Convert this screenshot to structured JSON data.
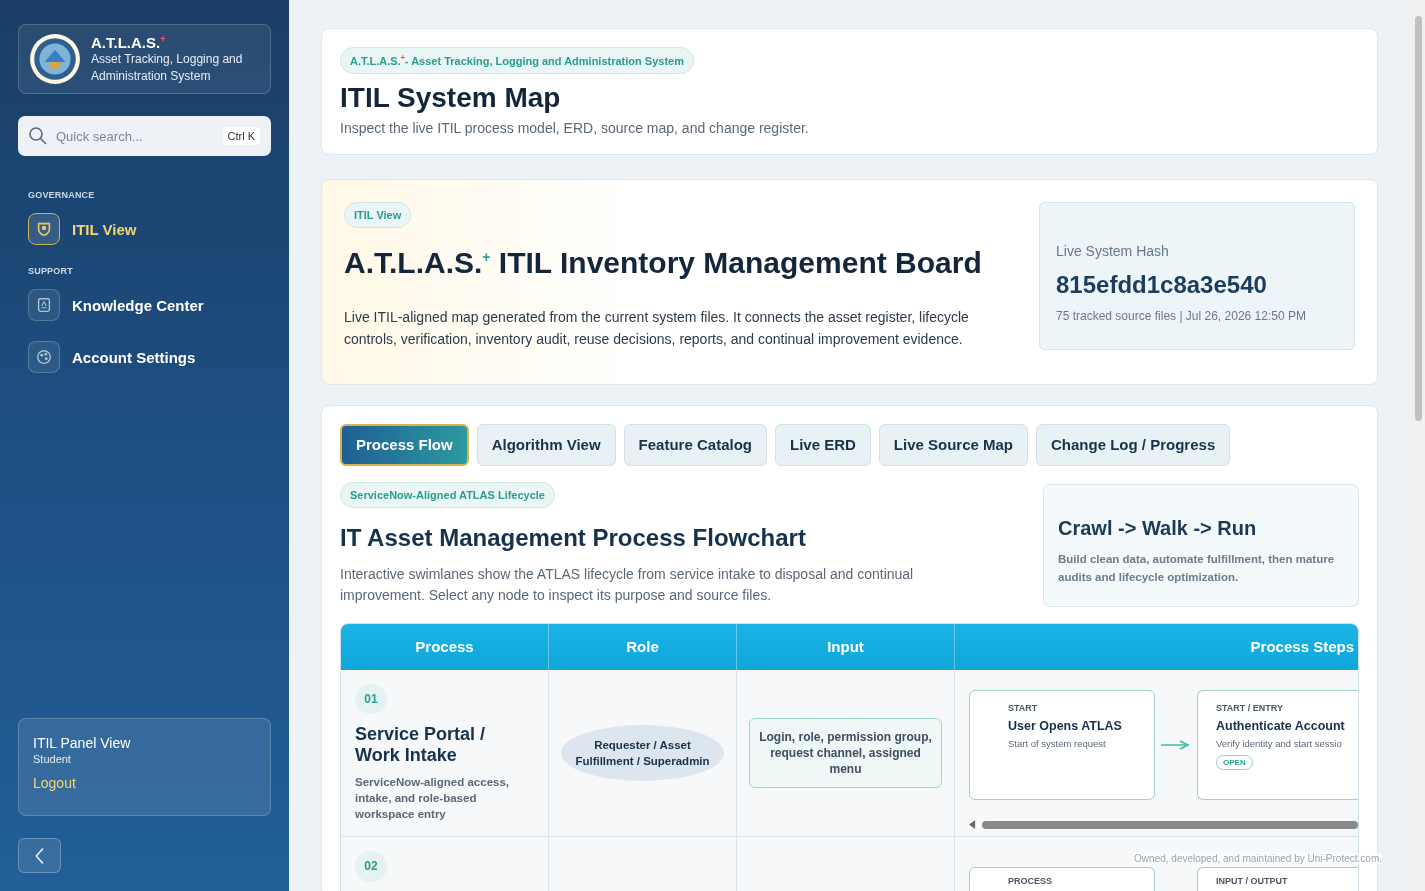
{
  "sidebar": {
    "brand": {
      "title": "A.T.L.A.S.$^{+}$",
      "subtitle": "Asset Tracking, Logging and Administration System"
    },
    "search": {
      "placeholder": "Quick search...",
      "shortcut": "Ctrl K"
    },
    "sections": [
      {
        "heading": "GOVERNANCE",
        "items": [
          {
            "label": "ITIL View",
            "selected": true
          }
        ]
      },
      {
        "heading": "SUPPORT",
        "items": [
          {
            "label": "Knowledge Center",
            "selected": false
          },
          {
            "label": "Account Settings",
            "selected": false
          }
        ]
      }
    ],
    "user": {
      "name": "ITIL Panel View",
      "role": "Student",
      "logout": "Logout"
    }
  },
  "header": {
    "chip": "A.T.L.A.S.$^{+}$- Asset Tracking, Logging and Administration System",
    "title": "ITIL System Map",
    "subtitle": "Inspect the live ITIL process model, ERD, source map, and change register."
  },
  "hero": {
    "chip": "ITIL View",
    "title": "A.T.L.A.S.$^{+}$ ITIL Inventory Management Board",
    "description": "Live ITIL-aligned map generated from the current system files. It connects the asset register, lifecycle controls, verification, inventory audit, reuse decisions, reports, and continual improvement evidence.",
    "hash_card": {
      "label": "Live System Hash",
      "value": "815efdd1c8a3e540",
      "meta": "75 tracked source files | Jul 26, 2026 12:50 PM"
    }
  },
  "tabs": [
    {
      "label": "Process Flow",
      "selected": true
    },
    {
      "label": "Algorithm View",
      "selected": false
    },
    {
      "label": "Feature Catalog",
      "selected": false
    },
    {
      "label": "Live ERD",
      "selected": false
    },
    {
      "label": "Live Source Map",
      "selected": false
    },
    {
      "label": "Change Log / Progress",
      "selected": false
    }
  ],
  "flow": {
    "chip": "ServiceNow-Aligned ATLAS Lifecycle",
    "title": "IT Asset Management Process Flowchart",
    "description": "Interactive swimlanes show the ATLAS lifecycle from service intake to disposal and continual improvement. Select any node to inspect its purpose and source files.",
    "aside": {
      "title": "Crawl -> Walk -> Run",
      "text": "Build clean data, automate fulfillment, then mature audits and lifecycle optimization."
    },
    "table": {
      "columns": [
        "Process",
        "Role",
        "Input",
        "Process Steps"
      ],
      "rows": [
        {
          "number": "01",
          "process": "Service Portal / Work Intake",
          "description": "ServiceNow-aligned access, intake, and role-based workspace entry",
          "role": "Requester / Asset Fulfillment / Superadmin",
          "input": "Login, role, permission group, request channel, assigned menu",
          "steps": [
            {
              "type": "START",
              "title": "User Opens ATLAS",
              "text": "Start of system request"
            },
            {
              "type": "START / ENTRY",
              "title": "Authenticate Account",
              "text": "Verify identity and start sessio",
              "badge": "OPEN"
            }
          ]
        },
        {
          "number": "02",
          "steps": [
            {
              "type": "PROCESS"
            },
            {
              "type": "INPUT / OUTPUT"
            }
          ]
        }
      ]
    }
  },
  "footer": "Owned, developed, and maintained by Uni-Protect.com."
}
